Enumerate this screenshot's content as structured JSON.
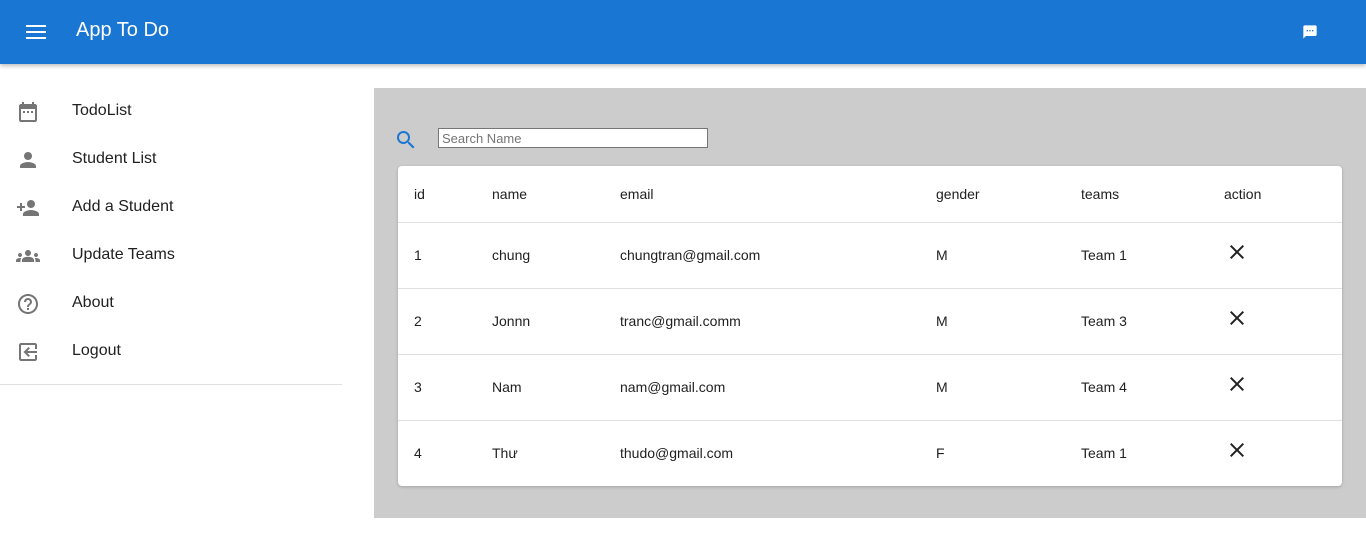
{
  "appbar": {
    "title": "App To Do",
    "menu_icon": "menu-icon",
    "chat_icon": "chat-icon",
    "color": "#1976d2"
  },
  "sidebar": {
    "items": [
      {
        "label": "TodoList",
        "icon": "calendar-icon"
      },
      {
        "label": "Student List",
        "icon": "person-icon"
      },
      {
        "label": "Add a Student",
        "icon": "person-add-icon"
      },
      {
        "label": "Update Teams",
        "icon": "group-icon"
      },
      {
        "label": "About",
        "icon": "help-icon"
      },
      {
        "label": "Logout",
        "icon": "logout-icon"
      }
    ]
  },
  "search": {
    "placeholder": "Search Name",
    "value": ""
  },
  "table": {
    "columns": [
      "id",
      "name",
      "email",
      "gender",
      "teams",
      "action"
    ],
    "rows": [
      {
        "id": "1",
        "name": "chung",
        "email": "chungtran@gmail.com",
        "gender": "M",
        "teams": "Team 1"
      },
      {
        "id": "2",
        "name": "Jonnn",
        "email": "tranc@gmail.comm",
        "gender": "M",
        "teams": "Team 3"
      },
      {
        "id": "3",
        "name": "Nam",
        "email": "nam@gmail.com",
        "gender": "M",
        "teams": "Team 4"
      },
      {
        "id": "4",
        "name": "Thư",
        "email": "thudo@gmail.com",
        "gender": "F",
        "teams": "Team 1"
      }
    ]
  }
}
